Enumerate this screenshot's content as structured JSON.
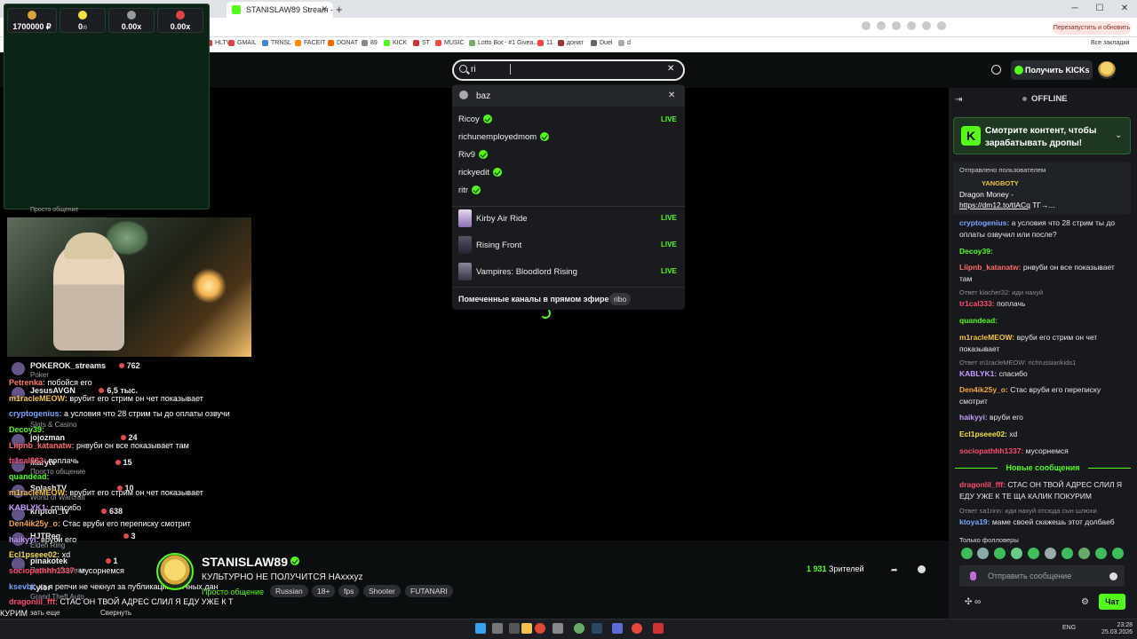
{
  "browser": {
    "active_tab_title": "STANISLAW89 Stream - Watch",
    "restart_label": "Перезапустить и обновить",
    "bookmarks": [
      "HLTV",
      "GMAIL",
      "TRNSL",
      "FACEIT",
      "DONAT",
      "89",
      "KICK",
      "ST",
      "MUSIC",
      "Lotto Bot - #1 Givea...",
      "11",
      "донат",
      "Duel",
      "d"
    ],
    "all_bookmarks": "Все закладки"
  },
  "header": {
    "search_value": "ri",
    "get_kicks_label": "Получить KICKs"
  },
  "search_dropdown": {
    "recent": "baz",
    "channels": [
      {
        "name": "Ricoy",
        "live": "LIVE"
      },
      {
        "name": "richunemployedmom",
        "live": ""
      },
      {
        "name": "Riv9",
        "live": ""
      },
      {
        "name": "rickyedit",
        "live": ""
      },
      {
        "name": "ritr",
        "live": ""
      }
    ],
    "categories": [
      {
        "name": "Kirby Air Ride",
        "live": "LIVE"
      },
      {
        "name": "Rising Front",
        "live": "LIVE"
      },
      {
        "name": "Vampires: Bloodlord Rising",
        "live": "LIVE"
      }
    ],
    "featured_label": "Помеченные каналы в прямом эфире",
    "featured_tag": "ribo"
  },
  "casino": {
    "balance": "1700000 ₽",
    "stat2": "0",
    "stat2_sub": "/0",
    "stat3": "0.00x",
    "stat4": "0.00x"
  },
  "overlay": {
    "category_caption": "Просто общение",
    "side_channels": [
      {
        "name": "POKEROK_streams",
        "viewers": "762",
        "category": "Poker"
      },
      {
        "name": "JesusAVGN",
        "viewers": "6,5 тыс.",
        "category": "Slots & Casino"
      },
      {
        "name": "jojozman",
        "viewers": "24",
        "category": "Doom: The Dark Ages"
      },
      {
        "name": "Marytv",
        "viewers": "15",
        "category": "Просто общение"
      },
      {
        "name": "SplashTV",
        "viewers": "10",
        "category": "World of Warcraft"
      },
      {
        "name": "kripton_tv",
        "viewers": "638",
        "category": "Просто общение"
      },
      {
        "name": "HJTReg",
        "viewers": "3",
        "category": "Elden Ring"
      },
      {
        "name": "pinakotek",
        "viewers": "1",
        "category": "Просто общение"
      },
      {
        "name": "Kylor",
        "viewers": "",
        "category": "Grand Theft Auto"
      }
    ],
    "show_more": "зать еще",
    "collapse": "Свернуть",
    "chat": [
      {
        "user": "Petrenka:",
        "text": "побойся его"
      },
      {
        "user": "m1racleMEOW:",
        "text": "врубит его стрим он чет показывает"
      },
      {
        "user": "cryptogenius:",
        "text": "а условия что 28 стрим ты до оплаты озвучи"
      },
      {
        "user": "Decoy39:",
        "text": ""
      },
      {
        "user": "Liipnb_katanatw:",
        "text": "рнвуби он все показывает там"
      },
      {
        "user": "tr1cal333:",
        "text": "поплачь"
      },
      {
        "user": "quandead:",
        "text": ""
      },
      {
        "user": "m1racleMEOW:",
        "text": "врубит его стрим он чет показывает"
      },
      {
        "user": "KABLYK1:",
        "text": "спасибо"
      },
      {
        "user": "Den4ik25y_o:",
        "text": "Стас вруби его переписку смотрит"
      },
      {
        "user": "haikyyi:",
        "text": "вруби его"
      },
      {
        "user": "Ecl1pseee02:",
        "text": "xd"
      },
      {
        "user": "sociopathhh1337:",
        "text": "мусорнемся"
      },
      {
        "user": "ksevbi:",
        "text": "хз я репчи не чекнул за публикацию личных дан"
      },
      {
        "user": "dragonlil_fff:",
        "text": "СТАС ОН ТВОЙ АДРЕС СЛИЛ Я ЕДУ УЖЕ К Т"
      },
      {
        "user": "",
        "text": "КУРИМ"
      }
    ]
  },
  "stream": {
    "streamer": "STANISLAW89",
    "title": "КУЛЬТУРНО НЕ ПОЛУЧИТСЯ НАxxxyz",
    "category": "Просто общение",
    "tags": [
      "Russian",
      "18+",
      "fps",
      "Shooter",
      "FUTANARI"
    ],
    "viewers": "1 931",
    "viewers_label": "Зрителей"
  },
  "chat": {
    "status": "OFFLINE",
    "drops_text": "Смотрите контент, чтобы зарабатывать дропы!",
    "pinned_by": "Отправлено пользователем",
    "pinned_user": "YANGBOTY",
    "pinned_text": "Dragon Money -",
    "pinned_link": "https://dm12.to/tIACq",
    "pinned_tail": "ТГ→...",
    "messages": [
      {
        "reply": "",
        "user": "cryptogenius:",
        "color": "#7aa7ff",
        "text": "а условия что 28 стрим ты до оплаты озвучил или после?"
      },
      {
        "reply": "",
        "user": "Decoy39:",
        "color": "#53fc18",
        "text": ""
      },
      {
        "reply": "",
        "user": "Liipnb_katanatw:",
        "color": "#ff6b6b",
        "text": "рнвуби он все показывает там"
      },
      {
        "reply": "Ответ klacher32: иди нахуй",
        "user": "tr1cal333:",
        "color": "#ff4d6d",
        "text": "поплачь"
      },
      {
        "reply": "",
        "user": "quandead:",
        "color": "#53fc18",
        "text": ""
      },
      {
        "reply": "",
        "user": "m1racleMEOW:",
        "color": "#f4c542",
        "text": "вруби его стрим он чет показывает"
      },
      {
        "reply": "Ответ m1racleMEOW: richrussiankids1",
        "user": "KABLYK1:",
        "color": "#c69cff",
        "text": "спасибо"
      },
      {
        "reply": "",
        "user": "Den4ik25y_o:",
        "color": "#f4a742",
        "text": "Стас вруби его переписку смотрит"
      },
      {
        "reply": "",
        "user": "haikyyi:",
        "color": "#c69cff",
        "text": "вруби его"
      },
      {
        "reply": "",
        "user": "Ecl1pseee02:",
        "color": "#f4e242",
        "text": "xd"
      },
      {
        "reply": "",
        "user": "sociopathhh1337:",
        "color": "#ff4d6d",
        "text": "мусорнемся"
      }
    ],
    "new_messages": "Новые сообщения",
    "after": [
      {
        "reply": "",
        "user": "dragonlil_fff:",
        "color": "#ff4d6d",
        "text": "СТАС ОН ТВОЙ АДРЕС СЛИЛ Я ЕДУ УЖЕ К ТЕ ЩА КАЛИК ПОКУРИМ"
      },
      {
        "reply": "Ответ sa1nnn: иди нахуй отсюда сын шлюхи",
        "user": "ktoya19:",
        "color": "#7aa7ff",
        "text": "маме своей скажешь этот долбаеб"
      }
    ],
    "followers_only": "Только фолловеры",
    "input_placeholder": "Отправить сообщение",
    "send_label": "Чат"
  },
  "taskbar": {
    "lang": "ENG",
    "time": "23:28",
    "date": "25.03.2026"
  }
}
